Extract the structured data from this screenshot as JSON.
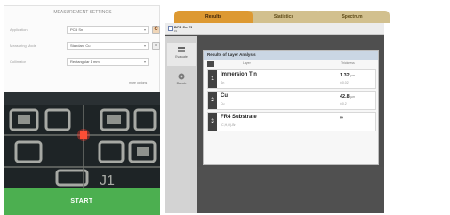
{
  "left": {
    "header": "MEASUREMENT SETTINGS",
    "fields": [
      {
        "label": "Application",
        "value": "PCB Sn"
      },
      {
        "label": "Measuring Mode",
        "value": "Standard Cu"
      },
      {
        "label": "Collimator",
        "value": "Rectangular 1 mm"
      }
    ],
    "c_button": "C",
    "bars_button": "≡",
    "more_link": "more options",
    "camera_label": "J1",
    "start": "START"
  },
  "tabs": [
    {
      "label": "Results",
      "active": true
    },
    {
      "label": "Statistics",
      "active": false
    },
    {
      "label": "Spectrum",
      "active": false
    }
  ],
  "file": {
    "name": "PCB Sn 73",
    "sub": "#1"
  },
  "nav": [
    {
      "label": "Evaluate",
      "icon": "layers-icon"
    },
    {
      "label": "Recalc",
      "icon": "gear-icon"
    }
  ],
  "results": {
    "title": "Results of Layer Analysis",
    "col_layer": "Layer",
    "col_thickness": "Thickness",
    "rows": [
      {
        "num": "1",
        "name": "Immersion Tin",
        "sub": "Sn",
        "value": "1.32",
        "unit": "µm",
        "value_sub": "± 0.02"
      },
      {
        "num": "2",
        "name": "Cu",
        "sub": "Cu",
        "value": "42.8",
        "unit": "µm",
        "value_sub": "± 0.2"
      },
      {
        "num": "3",
        "name": "FR4 Substrate",
        "sub": "(C,H,O)-Br",
        "value": "∞",
        "unit": "",
        "value_sub": ""
      }
    ]
  },
  "colors": {
    "active_tab": "#dd9932",
    "inactive_tab": "#d2c08e",
    "start": "#4caf50",
    "dark_panel": "#4f4f4f"
  }
}
